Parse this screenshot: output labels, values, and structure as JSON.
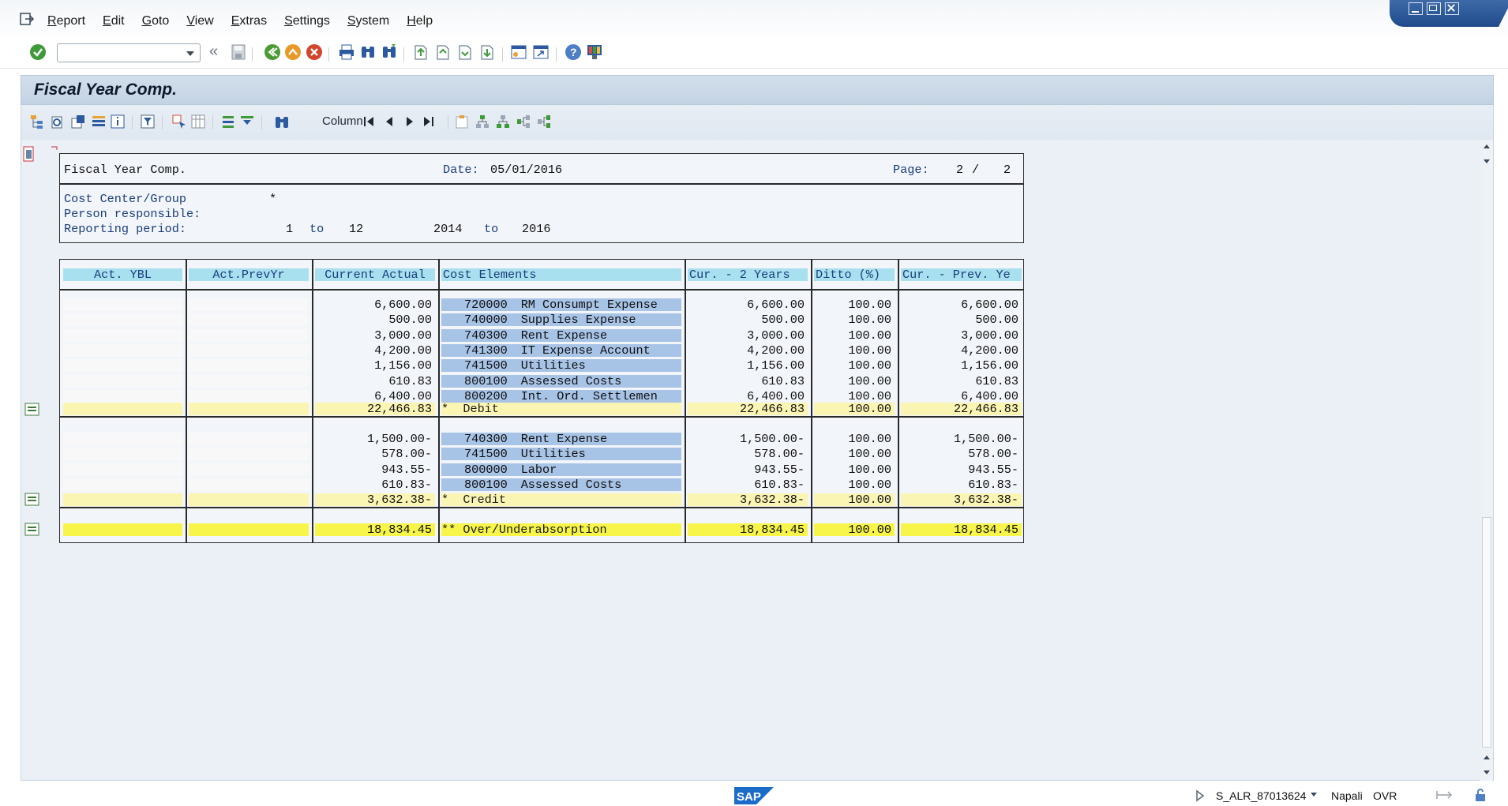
{
  "menu": [
    "Report",
    "Edit",
    "Goto",
    "View",
    "Extras",
    "Settings",
    "System",
    "Help"
  ],
  "title": "Fiscal Year Comp.",
  "app_toolbar": {
    "column_label": "Column"
  },
  "report_header": {
    "title": "Fiscal Year Comp.",
    "date_label": "Date:",
    "date_value": "05/01/2016",
    "page_label": "Page:",
    "page_current": "2",
    "page_sep": "/",
    "page_total": "2",
    "cost_center_label": "Cost Center/Group",
    "cost_center_value": "*",
    "person_label": "Person responsible:",
    "period_label": "Reporting period:",
    "period_from": "1",
    "period_to_word": "to",
    "period_to": "12",
    "year_from": "2014",
    "year_to_word": "to",
    "year_to": "2016"
  },
  "columns": [
    "Act. YBL",
    "Act.PrevYr",
    "Current Actual",
    "Cost Elements",
    "Cur. - 2 Years",
    "Ditto (%)",
    "Cur. - Prev. Ye"
  ],
  "debit_rows": [
    {
      "current": "6,600.00",
      "code": "720000",
      "name": "RM Consumpt Expense",
      "cur2": "6,600.00",
      "pct": "100.00",
      "curprev": "6,600.00"
    },
    {
      "current": "500.00",
      "code": "740000",
      "name": "Supplies Expense",
      "cur2": "500.00",
      "pct": "100.00",
      "curprev": "500.00"
    },
    {
      "current": "3,000.00",
      "code": "740300",
      "name": "Rent Expense",
      "cur2": "3,000.00",
      "pct": "100.00",
      "curprev": "3,000.00"
    },
    {
      "current": "4,200.00",
      "code": "741300",
      "name": "IT Expense Account",
      "cur2": "4,200.00",
      "pct": "100.00",
      "curprev": "4,200.00"
    },
    {
      "current": "1,156.00",
      "code": "741500",
      "name": "Utilities",
      "cur2": "1,156.00",
      "pct": "100.00",
      "curprev": "1,156.00"
    },
    {
      "current": "610.83",
      "code": "800100",
      "name": "Assessed Costs",
      "cur2": "610.83",
      "pct": "100.00",
      "curprev": "610.83"
    },
    {
      "current": "6,400.00",
      "code": "800200",
      "name": "Int. Ord. Settlemen",
      "cur2": "6,400.00",
      "pct": "100.00",
      "curprev": "6,400.00"
    }
  ],
  "debit_total": {
    "current": "22,466.83",
    "label": "*  Debit",
    "cur2": "22,466.83",
    "pct": "100.00",
    "curprev": "22,466.83"
  },
  "credit_rows": [
    {
      "current": "1,500.00-",
      "code": "740300",
      "name": "Rent Expense",
      "cur2": "1,500.00-",
      "pct": "100.00",
      "curprev": "1,500.00-"
    },
    {
      "current": "578.00-",
      "code": "741500",
      "name": "Utilities",
      "cur2": "578.00-",
      "pct": "100.00",
      "curprev": "578.00-"
    },
    {
      "current": "943.55-",
      "code": "800000",
      "name": "Labor",
      "cur2": "943.55-",
      "pct": "100.00",
      "curprev": "943.55-"
    },
    {
      "current": "610.83-",
      "code": "800100",
      "name": "Assessed Costs",
      "cur2": "610.83-",
      "pct": "100.00",
      "curprev": "610.83-"
    }
  ],
  "credit_total": {
    "current": "3,632.38-",
    "label": "*  Credit",
    "cur2": "3,632.38-",
    "pct": "100.00",
    "curprev": "3,632.38-"
  },
  "grand_total": {
    "current": "18,834.45",
    "label": "** Over/Underabsorption",
    "cur2": "18,834.45",
    "pct": "100.00",
    "curprev": "18,834.45"
  },
  "status": {
    "transaction": "S_ALR_87013624",
    "host": "Napali",
    "mode": "OVR"
  },
  "colors": {
    "header_cell": "#a8e0f0",
    "cost_element": "#a7c3e6",
    "subtotal": "#fbf5b3",
    "total": "#f7f54a",
    "title_bar": "#c4d3e4"
  }
}
